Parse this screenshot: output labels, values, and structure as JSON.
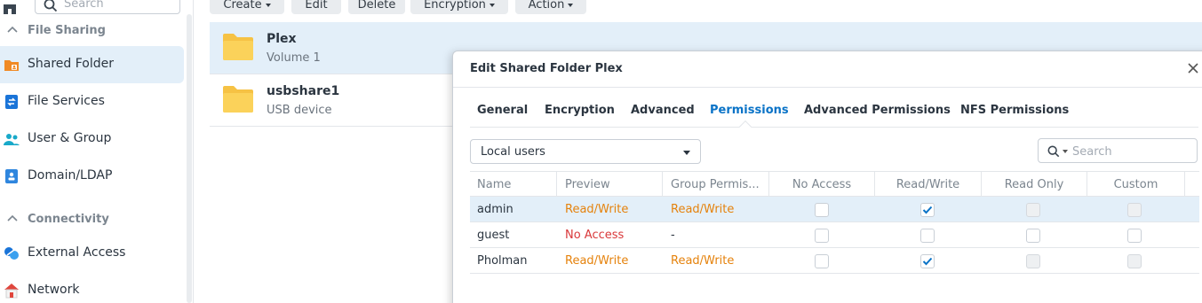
{
  "sidebar": {
    "search_placeholder": "Search",
    "sections": [
      {
        "title": "File Sharing",
        "items": [
          {
            "label": "Shared Folder",
            "icon": "shared-folder-icon",
            "active": true
          },
          {
            "label": "File Services",
            "icon": "file-services-icon"
          },
          {
            "label": "User & Group",
            "icon": "user-group-icon"
          },
          {
            "label": "Domain/LDAP",
            "icon": "domain-ldap-icon"
          }
        ]
      },
      {
        "title": "Connectivity",
        "items": [
          {
            "label": "External Access",
            "icon": "external-access-icon"
          },
          {
            "label": "Network",
            "icon": "network-icon"
          }
        ]
      }
    ]
  },
  "toolbar": {
    "create": "Create",
    "edit": "Edit",
    "delete": "Delete",
    "encryption": "Encryption",
    "action": "Action"
  },
  "folders": [
    {
      "name": "Plex",
      "location": "Volume 1",
      "selected": true
    },
    {
      "name": "usbshare1",
      "location": "USB device",
      "selected": false
    }
  ],
  "dialog": {
    "title": "Edit Shared Folder Plex",
    "tabs": [
      "General",
      "Encryption",
      "Advanced",
      "Permissions",
      "Advanced Permissions",
      "NFS Permissions"
    ],
    "active_tab": "Permissions",
    "user_type": "Local users",
    "search_placeholder": "Search",
    "columns": [
      "Name",
      "Preview",
      "Group Permis...",
      "No Access",
      "Read/Write",
      "Read Only",
      "Custom"
    ],
    "rows": [
      {
        "name": "admin",
        "preview": "Read/Write",
        "group": "Read/Write",
        "no_access": false,
        "read_write": true,
        "read_only": false,
        "custom": false,
        "selected": true
      },
      {
        "name": "guest",
        "preview": "No Access",
        "group": "-",
        "no_access": false,
        "read_write": false,
        "read_only": false,
        "custom": false,
        "selected": false
      },
      {
        "name": "Pholman",
        "preview": "Read/Write",
        "group": "Read/Write",
        "no_access": false,
        "read_write": true,
        "read_only": false,
        "custom": false,
        "selected": false
      }
    ]
  },
  "colors": {
    "accent": "#0a73c7",
    "selection": "#e3eff9",
    "read_write": "#e5820c",
    "no_access": "#d9383a",
    "folder": "#f6c244"
  }
}
